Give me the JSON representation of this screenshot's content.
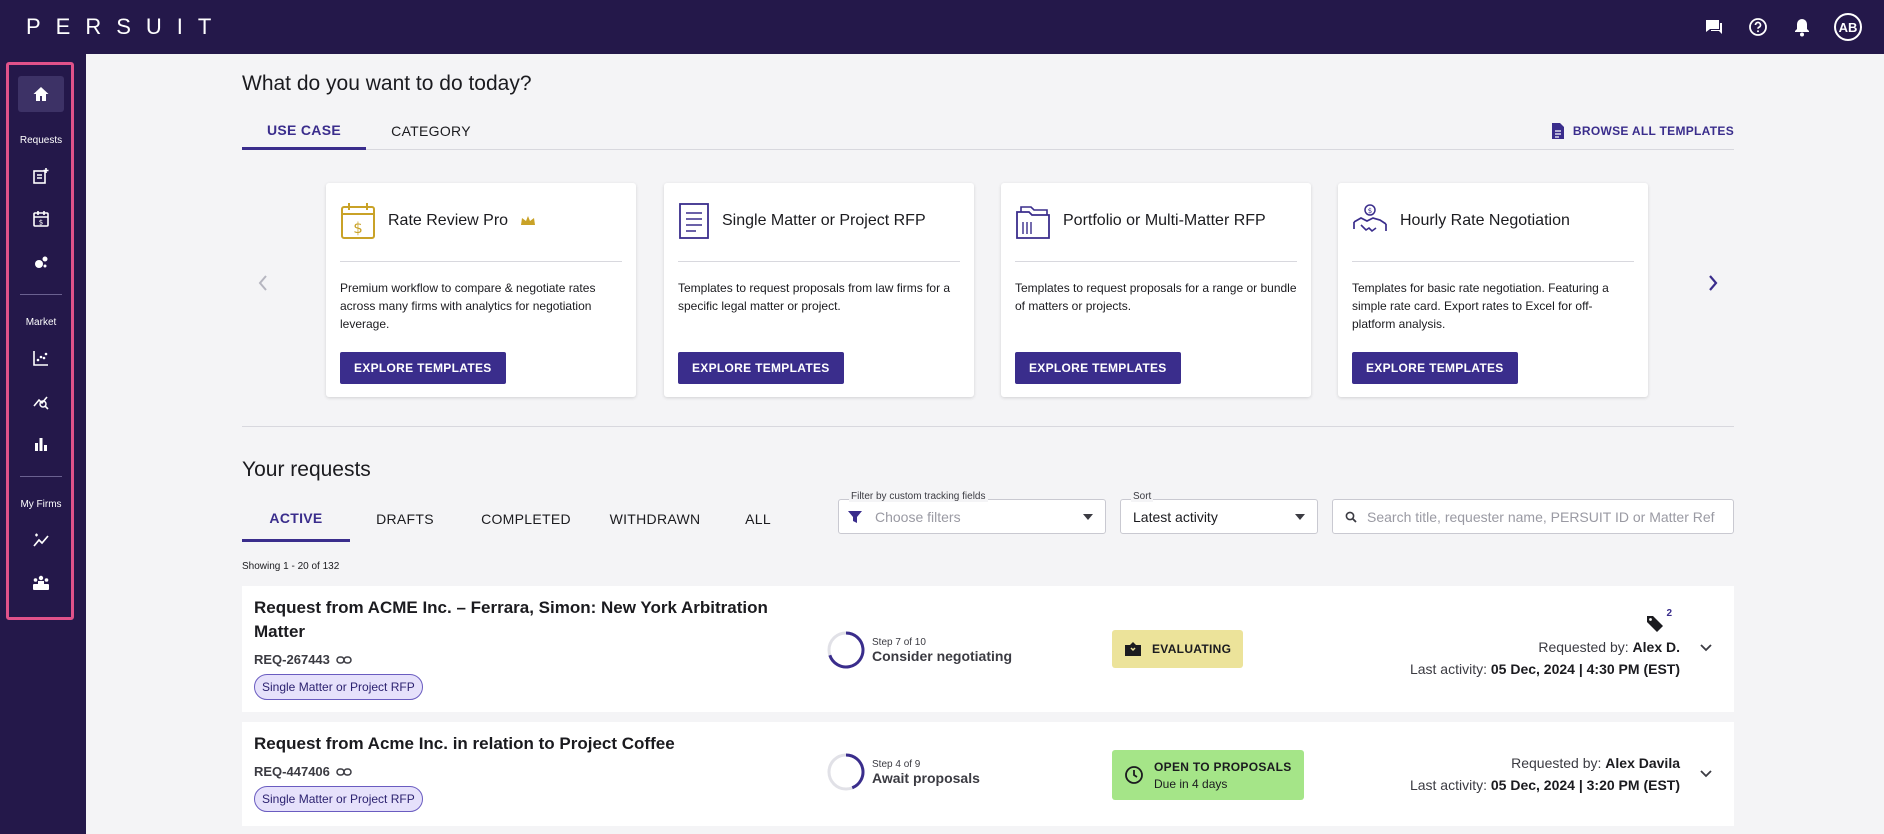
{
  "app": {
    "logo": "PERSUIT",
    "avatar_initials": "AB"
  },
  "topbar_icons": [
    "chat-icon",
    "help-icon",
    "bell-icon"
  ],
  "rail": {
    "requests_label": "Requests",
    "market_label": "Market",
    "myfirms_label": "My Firms"
  },
  "page": {
    "title": "What do you want to do today?"
  },
  "top_tabs": {
    "use_case": "USE CASE",
    "category": "CATEGORY",
    "browse": "BROWSE ALL TEMPLATES"
  },
  "cards": [
    {
      "title": "Rate Review Pro",
      "desc": "Premium workflow to compare & negotiate rates across many firms with analytics for negotiation leverage.",
      "button": "EXPLORE TEMPLATES",
      "icon": "calendar-dollar-icon",
      "premium": true
    },
    {
      "title": "Single Matter or Project RFP",
      "desc": "Templates to request proposals from law firms for a specific legal matter or project.",
      "button": "EXPLORE TEMPLATES",
      "icon": "document-icon"
    },
    {
      "title": "Portfolio or Multi-Matter RFP",
      "desc": "Templates to request proposals for a range or bundle of matters or projects.",
      "button": "EXPLORE TEMPLATES",
      "icon": "folders-icon"
    },
    {
      "title": "Hourly Rate Negotiation",
      "desc": "Templates for basic rate negotiation. Featuring a simple rate card. Export rates to Excel for off-platform analysis.",
      "button": "EXPLORE TEMPLATES",
      "icon": "handshake-icon"
    }
  ],
  "requests": {
    "title": "Your requests",
    "tabs": [
      "ACTIVE",
      "DRAFTS",
      "COMPLETED",
      "WITHDRAWN",
      "ALL"
    ],
    "filter": {
      "label": "Filter by custom tracking fields",
      "placeholder": "Choose filters"
    },
    "sort": {
      "label": "Sort",
      "value": "Latest activity"
    },
    "search": {
      "placeholder": "Search title, requester name, PERSUIT ID or Matter Ref"
    },
    "showing": "Showing 1 - 20 of 132",
    "rows": [
      {
        "title": "Request from ACME Inc. – Ferrara, Simon: New York Arbitration Matter",
        "id": "REQ-267443",
        "chip": "Single Matter or Project RFP",
        "step_small": "Step 7 of 10",
        "step_big": "Consider negotiating",
        "step_progress": 0.7,
        "status": "EVALUATING",
        "status_sub": "",
        "tag_count": "2",
        "requested_by_label": "Requested by:",
        "requested_by": "Alex D.",
        "last_activity_label": "Last activity:",
        "last_activity": "05 Dec, 2024 | 4:30 PM (EST)"
      },
      {
        "title": "Request from Acme Inc. in relation to Project Coffee",
        "id": "REQ-447406",
        "chip": "Single Matter or Project RFP",
        "step_small": "Step 4 of 9",
        "step_big": "Await proposals",
        "step_progress": 0.44,
        "status": "OPEN TO PROPOSALS",
        "status_sub": "Due in 4 days",
        "requested_by_label": "Requested by:",
        "requested_by": "Alex Davila",
        "last_activity_label": "Last activity:",
        "last_activity": "05 Dec, 2024 | 3:20 PM (EST)"
      }
    ]
  },
  "colors": {
    "navy": "#24184a",
    "accent": "#3a2d8c",
    "highlight": "#e0528a",
    "evaluating": "#ece39a",
    "open": "#a5e588"
  }
}
